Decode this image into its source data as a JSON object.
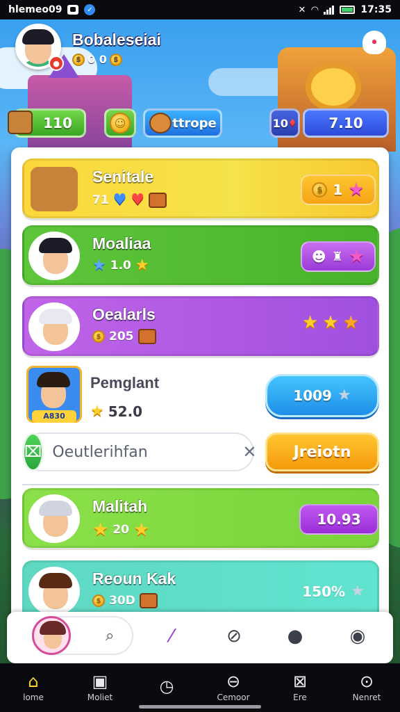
{
  "status_bar": {
    "left_text": "hlemeo09",
    "time": "17:35"
  },
  "player": {
    "name": "Bobaleseiai",
    "sub_value": "0 0"
  },
  "resources": {
    "green_value": "110",
    "blue_value": "ttrope",
    "small_value": "10",
    "right_value": "7.10"
  },
  "cards": [
    {
      "title": "Senitale",
      "sub_value": "71",
      "pill_value": "1",
      "color": "#fbd83c"
    },
    {
      "title": "Moaliaa",
      "sub_value": "1.0",
      "color": "#5ec63a"
    },
    {
      "title": "Oealarls",
      "sub_value": "205",
      "color": "#c064e8"
    },
    {
      "title": "Pemglant",
      "sub_value": "52.0",
      "pill_value": "1009",
      "avatar_label": "A830"
    },
    {
      "title": "Malitah",
      "sub_value": "20",
      "pill_value": "10.93",
      "color": "#8be04a"
    },
    {
      "title": "Reoun Kak",
      "sub_value": "30D",
      "pill_value": "150%",
      "color": "#5fd8c2"
    }
  ],
  "search": {
    "value": "Oeutlerihfan",
    "button_label": "Jreiotn"
  },
  "nav": [
    {
      "label": "lome",
      "icon": "home-icon"
    },
    {
      "label": "Moliet",
      "icon": "id-card-icon"
    },
    {
      "label": "",
      "icon": "clock-icon"
    },
    {
      "label": "Cemoor",
      "icon": "search-bubble-icon"
    },
    {
      "label": "Ere",
      "icon": "box-x-icon"
    },
    {
      "label": "Nenret",
      "icon": "chat-search-icon"
    }
  ]
}
